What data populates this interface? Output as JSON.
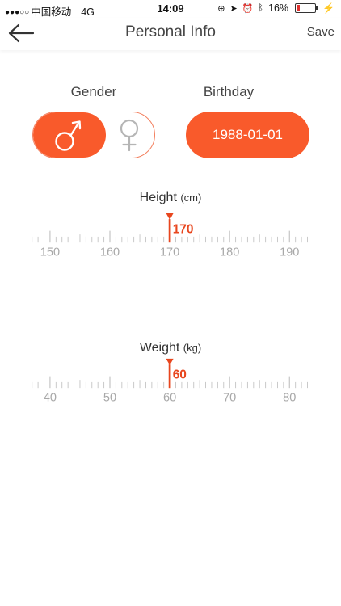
{
  "status": {
    "carrier": "中国移动",
    "network": "4G",
    "time": "14:09",
    "battery": "16%",
    "battery_level": 0.16
  },
  "nav": {
    "title": "Personal Info",
    "save_label": "Save"
  },
  "labels": {
    "gender": "Gender",
    "birthday": "Birthday"
  },
  "gender": {
    "selected": "male"
  },
  "birthday": "1988-01-01",
  "height": {
    "label": "Height",
    "unit": "(cm)",
    "value": 170,
    "ticks": [
      150,
      160,
      170,
      180,
      190
    ]
  },
  "weight": {
    "label": "Weight",
    "unit": "(kg)",
    "value": 60,
    "ticks": [
      40,
      50,
      60,
      70,
      80
    ]
  },
  "colors": {
    "accent": "#f95a2b",
    "indicator": "#e8461e",
    "tick": "#c4c4c4",
    "tick_label": "#a8a8a8"
  }
}
